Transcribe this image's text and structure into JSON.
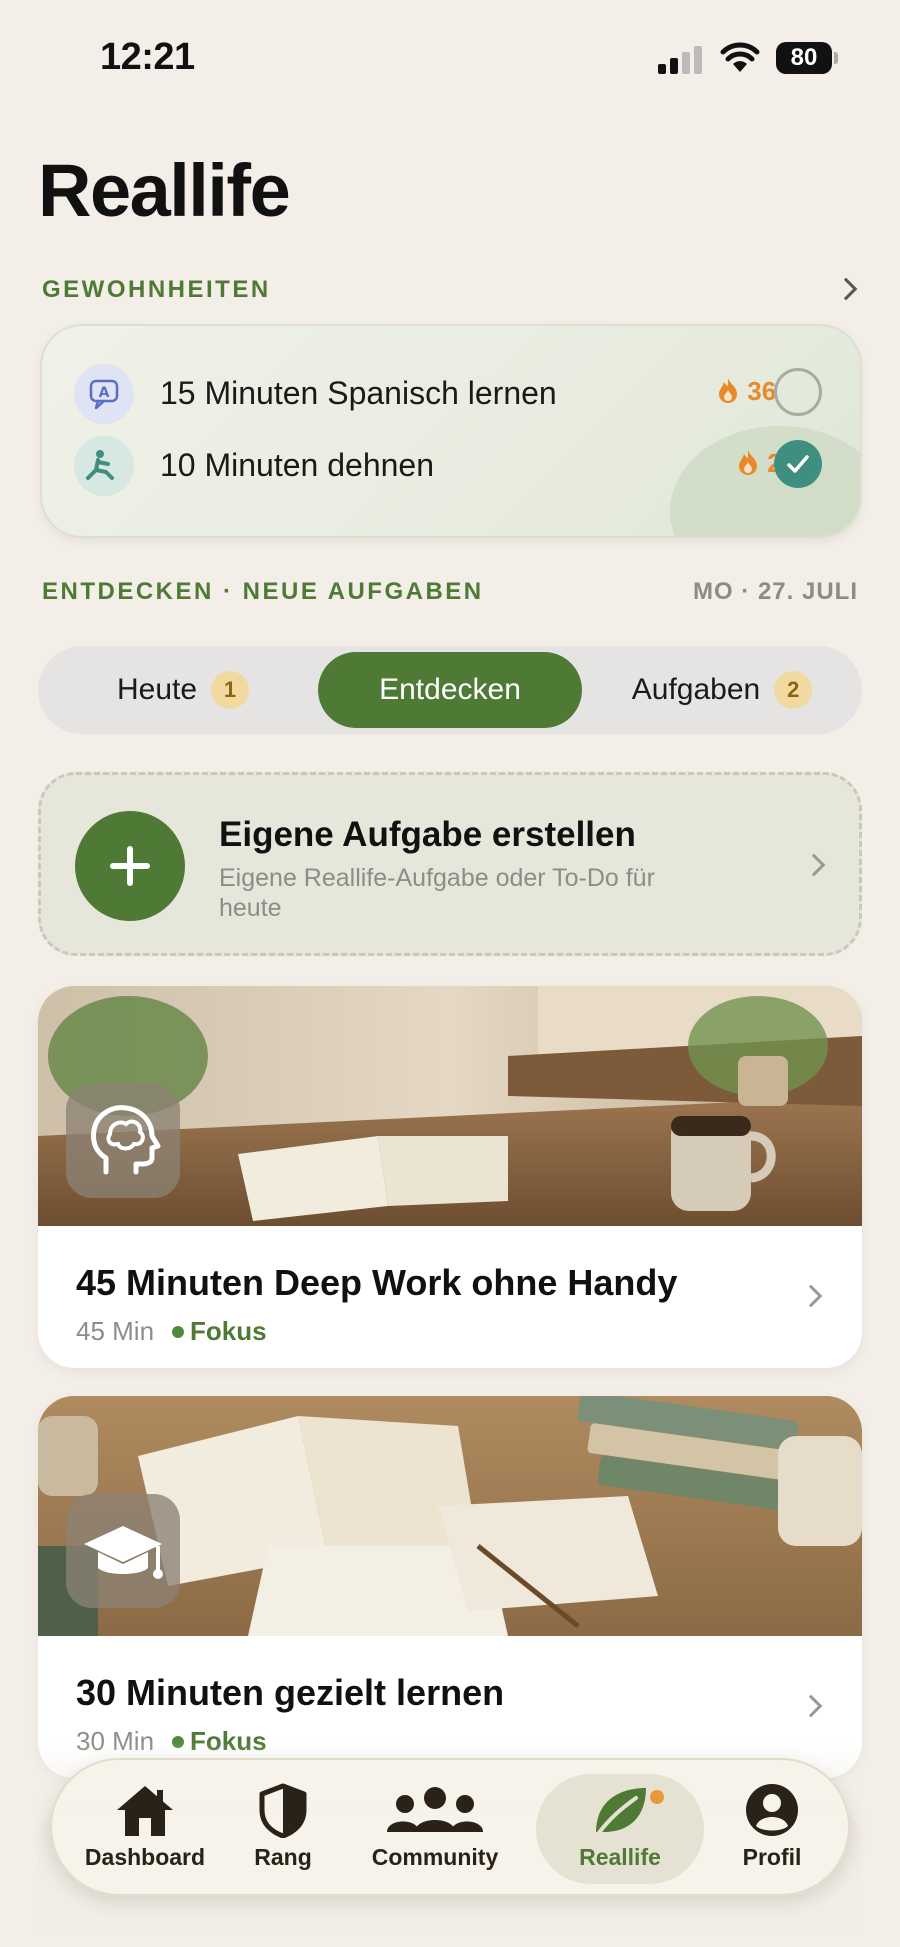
{
  "status_bar": {
    "time": "12:21",
    "battery": "80"
  },
  "page_title": "Reallife",
  "habits_section": {
    "label": "GEWOHNHEITEN",
    "items": [
      {
        "label": "15 Minuten Spanisch lernen",
        "streak": "36",
        "done": false,
        "icon": "translate-icon"
      },
      {
        "label": "10 Minuten dehnen",
        "streak": "2",
        "done": true,
        "icon": "stretch-icon"
      }
    ]
  },
  "discover_section": {
    "label": "ENTDECKEN · NEUE AUFGABEN",
    "date": "MO · 27. JULI"
  },
  "tabs": [
    {
      "label": "Heute",
      "badge": "1",
      "active": false
    },
    {
      "label": "Entdecken",
      "badge": "",
      "active": true
    },
    {
      "label": "Aufgaben",
      "badge": "2",
      "active": false
    }
  ],
  "create_task": {
    "title": "Eigene Aufgabe erstellen",
    "subtitle": "Eigene Reallife-Aufgabe oder To-Do für heute"
  },
  "tasks": [
    {
      "title": "45 Minuten Deep Work ohne Handy",
      "duration": "45 Min",
      "category": "Fokus",
      "icon": "brain-head-icon"
    },
    {
      "title": "30 Minuten gezielt lernen",
      "duration": "30 Min",
      "category": "Fokus",
      "icon": "graduation-cap-icon"
    }
  ],
  "tab_bar": [
    {
      "label": "Dashboard",
      "icon": "home-icon",
      "active": false
    },
    {
      "label": "Rang",
      "icon": "shield-icon",
      "active": false
    },
    {
      "label": "Community",
      "icon": "people-icon",
      "active": false
    },
    {
      "label": "Reallife",
      "icon": "leaf-icon",
      "active": true
    },
    {
      "label": "Profil",
      "icon": "profile-icon",
      "active": false
    }
  ],
  "colors": {
    "accent_green": "#4e7a35",
    "streak_orange": "#e8892c",
    "check_teal": "#3f8f80",
    "background": "#f3efe8"
  }
}
